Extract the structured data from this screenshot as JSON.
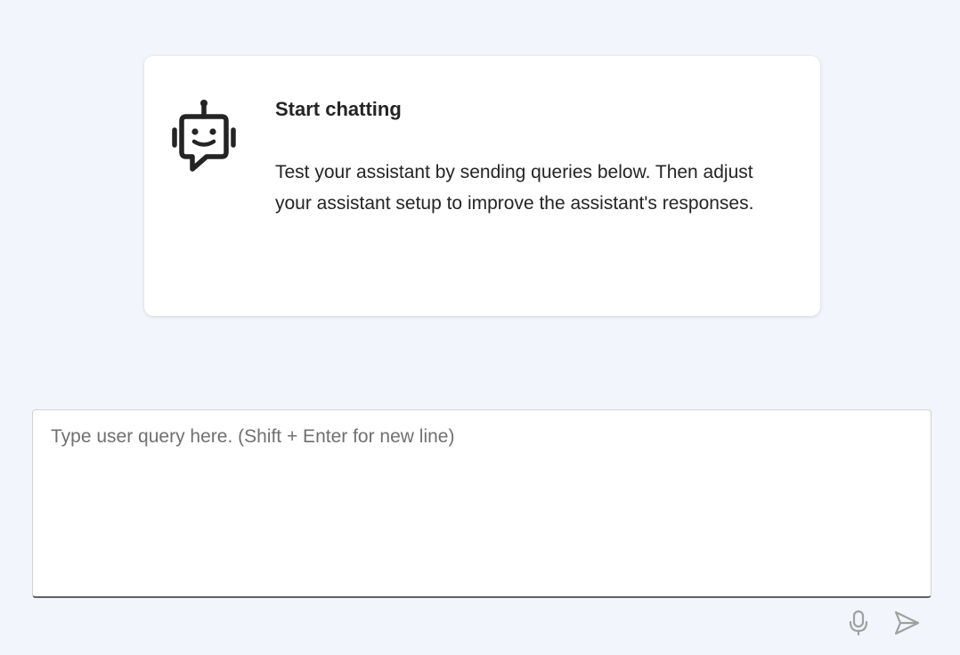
{
  "welcome": {
    "title": "Start chatting",
    "body": "Test your assistant by sending queries below. Then adjust your assistant setup to improve the assistant's responses.",
    "icon": "bot-icon"
  },
  "composer": {
    "placeholder": "Type user query here. (Shift + Enter for new line)",
    "value": "",
    "mic_icon": "microphone-icon",
    "send_icon": "send-icon"
  },
  "colors": {
    "page_background": "#f2f6fc",
    "card_background": "#ffffff",
    "text": "#242424",
    "placeholder": "#707070",
    "icon_disabled": "#a0a0a0"
  }
}
